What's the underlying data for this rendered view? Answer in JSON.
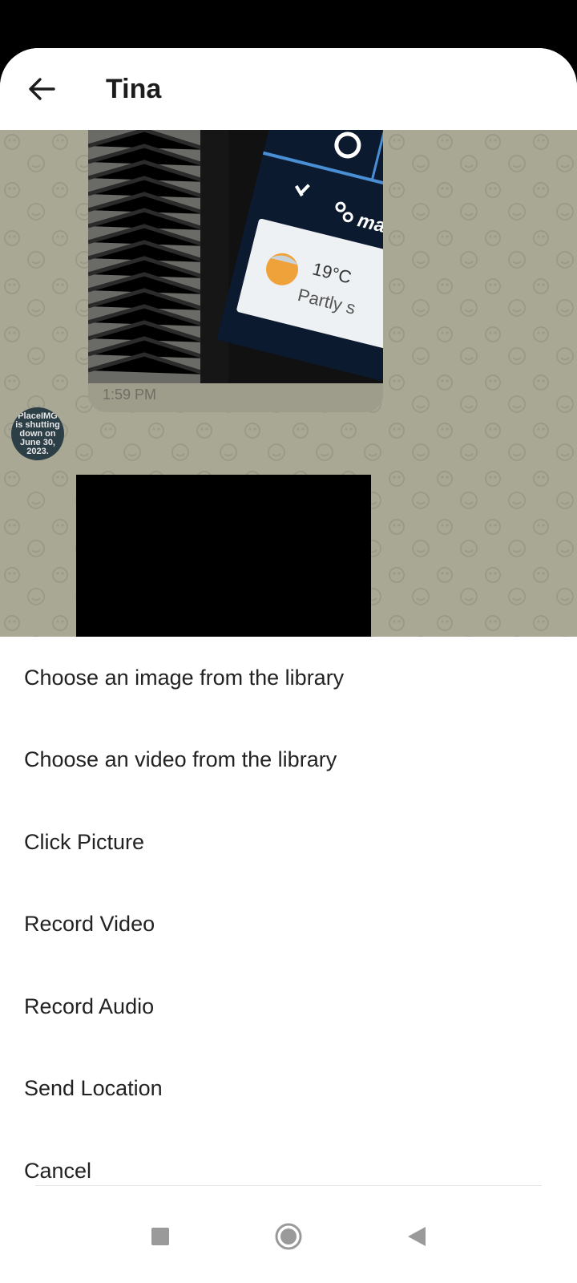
{
  "header": {
    "title": "Tina",
    "back_icon": "arrow-left-icon"
  },
  "chat": {
    "message_time": "1:59 PM",
    "photo": {
      "temperature": "19°C",
      "condition": "Partly s",
      "partial_text": "ma"
    },
    "avatar_text": "PlaceIMG\nis shutting\ndown on\nJune 30,\n2023."
  },
  "sheet": {
    "options": [
      "Choose an image from the library",
      "Choose an video from the library",
      "Click Picture",
      "Record Video",
      "Record Audio",
      "Send Location",
      "Cancel"
    ]
  },
  "nav": {
    "recents_icon": "square-icon",
    "home_icon": "circle-icon",
    "back_icon": "triangle-back-icon"
  },
  "colors": {
    "chat_background": "#a9a895",
    "sheet_background": "#ffffff",
    "text": "#222222"
  }
}
